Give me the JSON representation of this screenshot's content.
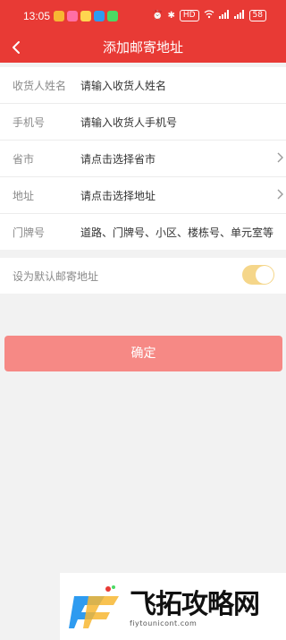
{
  "status_bar": {
    "time": "13:05",
    "network_label": "HD",
    "battery": "58"
  },
  "header": {
    "title": "添加邮寄地址"
  },
  "form": {
    "name": {
      "label": "收货人姓名",
      "placeholder": "请输入收货人姓名"
    },
    "phone": {
      "label": "手机号",
      "placeholder": "请输入收货人手机号"
    },
    "province": {
      "label": "省市",
      "value": "请点击选择省市"
    },
    "address": {
      "label": "地址",
      "value": "请点击选择地址"
    },
    "door": {
      "label": "门牌号",
      "placeholder": "道路、门牌号、小区、楼栋号、单元室等"
    }
  },
  "default_address": {
    "label": "设为默认邮寄地址",
    "enabled": true
  },
  "confirm_button": {
    "label": "确定"
  },
  "watermark": {
    "text": "飞拓攻略网",
    "url": "fiytounicont.com"
  },
  "colors": {
    "primary": "#e83a35",
    "button": "#f68985",
    "toggle": "#f5d68a"
  }
}
